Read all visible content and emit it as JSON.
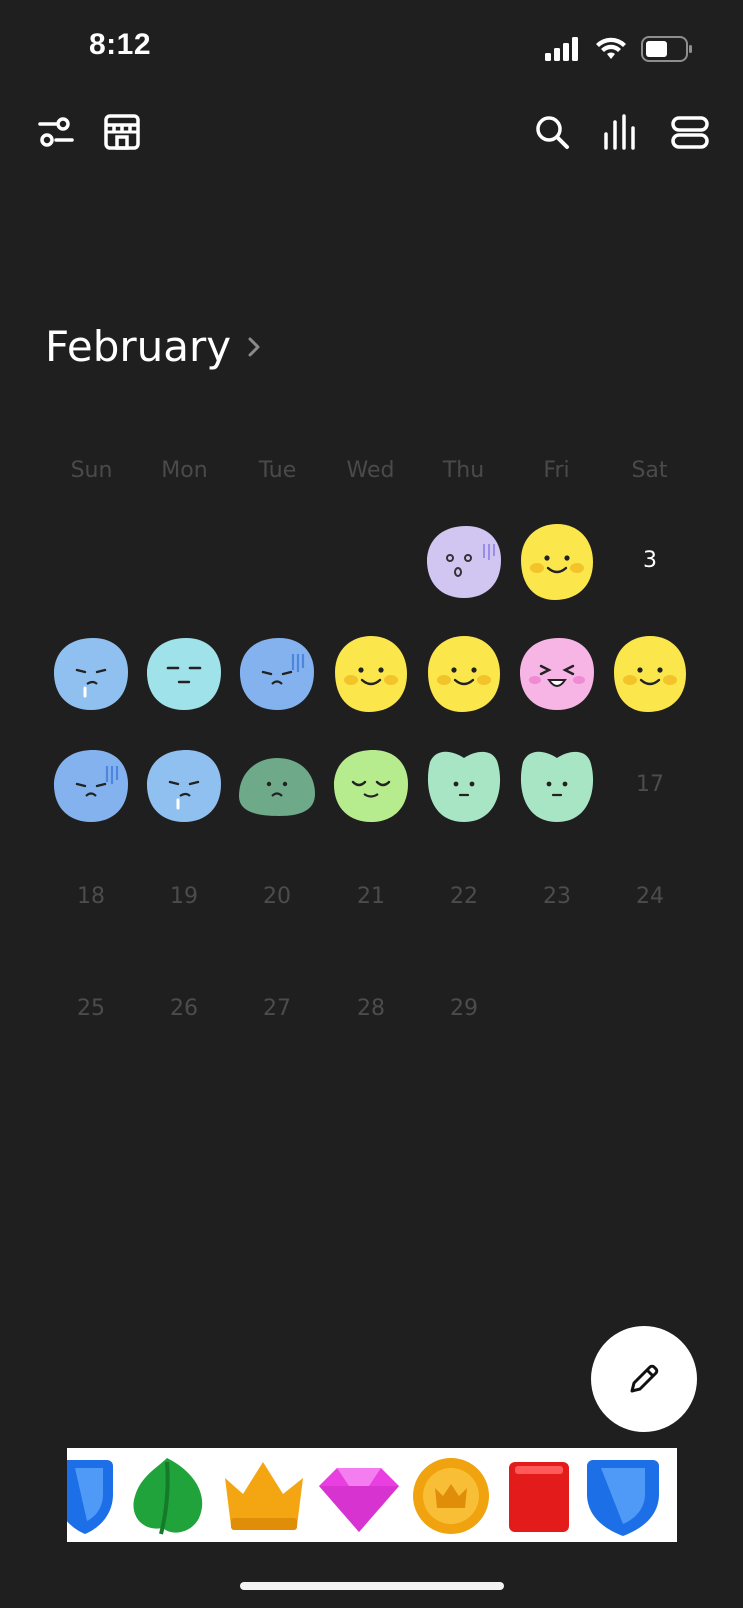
{
  "status_bar": {
    "time": "8:12"
  },
  "toolbar": {
    "left_icons": [
      "settings-sliders-icon",
      "store-icon"
    ],
    "right_icons": [
      "search-icon",
      "stats-icon",
      "list-view-icon"
    ]
  },
  "calendar": {
    "month": "February",
    "weekdays": [
      "Sun",
      "Mon",
      "Tue",
      "Wed",
      "Thu",
      "Fri",
      "Sat"
    ],
    "day_numbers": [
      {
        "label": "3",
        "today": true
      },
      {
        "label": "17"
      },
      {
        "label": "18"
      },
      {
        "label": "19"
      },
      {
        "label": "20"
      },
      {
        "label": "21"
      },
      {
        "label": "22"
      },
      {
        "label": "23"
      },
      {
        "label": "24"
      },
      {
        "label": "25"
      },
      {
        "label": "26"
      },
      {
        "label": "27"
      },
      {
        "label": "28"
      },
      {
        "label": "29"
      }
    ],
    "moods": [
      {
        "day": 1,
        "mood": "shocked",
        "color": "#d1c6f2"
      },
      {
        "day": 2,
        "mood": "happy",
        "color": "#fbe64b"
      },
      {
        "day": 4,
        "mood": "sad-tear",
        "color": "#8fc0f0"
      },
      {
        "day": 5,
        "mood": "annoyed",
        "color": "#9fe2ea"
      },
      {
        "day": 6,
        "mood": "gloomy",
        "color": "#84b2ef"
      },
      {
        "day": 7,
        "mood": "happy",
        "color": "#fbe64b"
      },
      {
        "day": 8,
        "mood": "happy",
        "color": "#fbe64b"
      },
      {
        "day": 9,
        "mood": "laughing",
        "color": "#f7b5e5"
      },
      {
        "day": 10,
        "mood": "happy",
        "color": "#fbe64b"
      },
      {
        "day": 11,
        "mood": "gloomy",
        "color": "#84b2ef"
      },
      {
        "day": 12,
        "mood": "sad-tear",
        "color": "#8fc0f0"
      },
      {
        "day": 13,
        "mood": "down",
        "color": "#6ea98a"
      },
      {
        "day": 14,
        "mood": "content",
        "color": "#b6ec8e"
      },
      {
        "day": 15,
        "mood": "neutral",
        "color": "#a8e5c4"
      },
      {
        "day": 16,
        "mood": "neutral",
        "color": "#a8e5c4"
      }
    ]
  },
  "fab": {
    "icon": "pencil-icon"
  },
  "ad_banner": {
    "items": [
      "blue-shield-icon",
      "green-leaf-icon",
      "gold-crown-icon",
      "pink-gem-icon",
      "gold-coin-icon",
      "red-book-icon",
      "blue-shield-icon"
    ]
  }
}
